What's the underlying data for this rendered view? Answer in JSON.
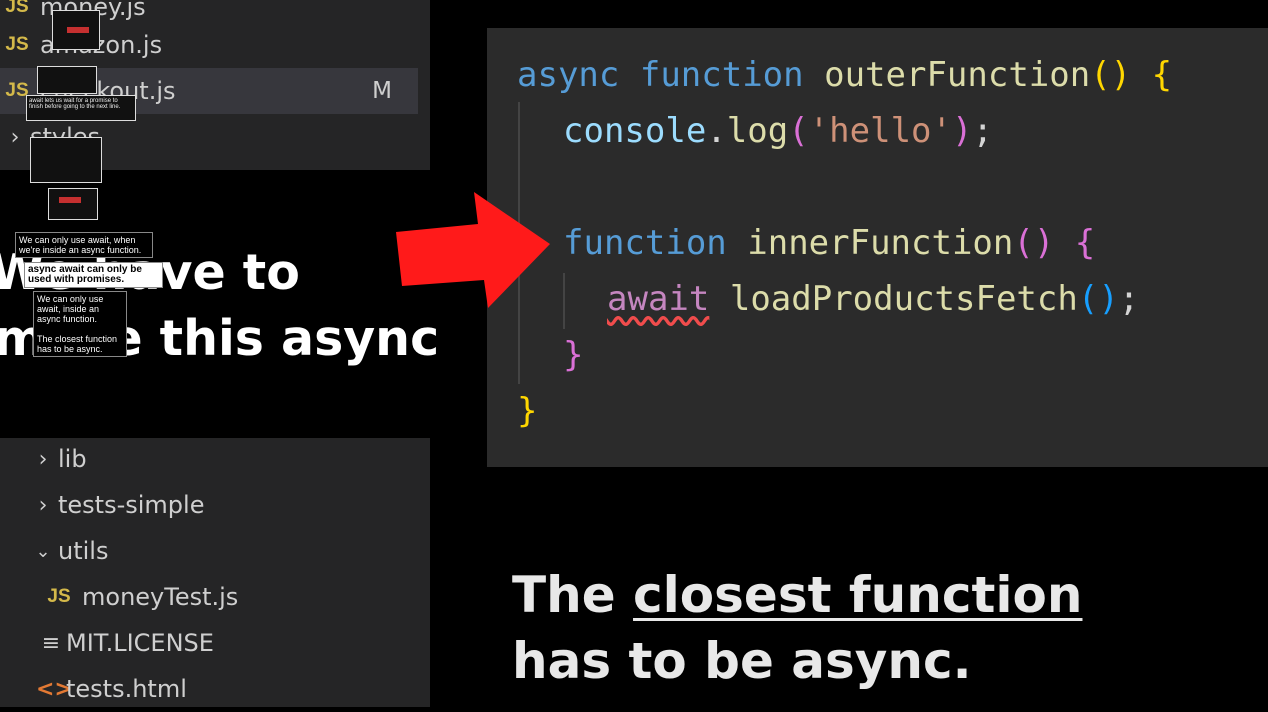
{
  "explorer": {
    "top_items": [
      {
        "icon": "JS",
        "label": "money.js"
      },
      {
        "icon": "JS",
        "label": "amazon.js"
      },
      {
        "icon": "JS",
        "label": "checkout.js",
        "badge": "M"
      },
      {
        "icon": "chevron-right",
        "label": "styles"
      }
    ],
    "bottom_items": [
      {
        "icon": "chevron-right",
        "label": "lib"
      },
      {
        "icon": "chevron-right",
        "label": "tests-simple"
      },
      {
        "icon": "chevron-down",
        "label": "utils"
      },
      {
        "icon": "JS",
        "label": "moneyTest.js"
      },
      {
        "icon": "license",
        "label": "MIT.LICENSE"
      },
      {
        "icon": "html",
        "label": "tests.html"
      }
    ]
  },
  "overlays": {
    "caption_1": "We can only use await, when we're inside an async function.",
    "caption_2": "async await can only be used with promises.",
    "caption_3": "We can only use await, inside an async function.",
    "caption_4": "The closest function has to be async.",
    "thumb_text_1": "await lets us wait for a promise to finish before going to the next line.",
    "left_caption_line1": "We have to",
    "left_caption_line2": "make this async"
  },
  "code": {
    "line1_kw1": "async",
    "line1_kw2": "function",
    "line1_name": "outerFunction",
    "line2_obj": "console",
    "line2_method": "log",
    "line2_str": "'hello'",
    "line4_kw": "function",
    "line4_name": "innerFunction",
    "line5_kw": "await",
    "line5_call": "loadProductsFetch"
  },
  "bottom_caption": {
    "pre": "The ",
    "underlined": "closest function",
    "line2": "has to be async."
  },
  "colors": {
    "arrow": "#ff1a1a",
    "keyword": "#569cd6",
    "function_name": "#dcdcaa"
  }
}
